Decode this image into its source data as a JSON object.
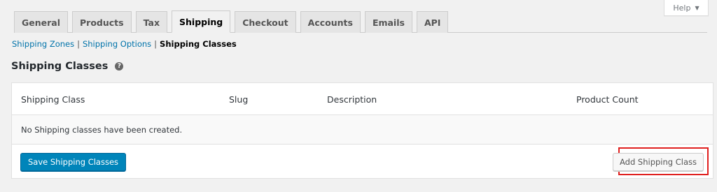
{
  "help": {
    "label": "Help",
    "caret": "▼"
  },
  "tabs": [
    {
      "label": "General"
    },
    {
      "label": "Products"
    },
    {
      "label": "Tax"
    },
    {
      "label": "Shipping"
    },
    {
      "label": "Checkout"
    },
    {
      "label": "Accounts"
    },
    {
      "label": "Emails"
    },
    {
      "label": "API"
    }
  ],
  "active_tab": "Shipping",
  "subnav": {
    "zones": "Shipping Zones",
    "options": "Shipping Options",
    "classes": "Shipping Classes",
    "separator": "|"
  },
  "section": {
    "title": "Shipping Classes",
    "help_icon": "?"
  },
  "table": {
    "columns": [
      "Shipping Class",
      "Slug",
      "Description",
      "Product Count"
    ],
    "empty_message": "No Shipping classes have been created."
  },
  "actions": {
    "save_label": "Save Shipping Classes",
    "add_label": "Add Shipping Class"
  },
  "colors": {
    "primary_button": "#0085ba",
    "link": "#0073aa",
    "highlight": "#e0201f"
  }
}
